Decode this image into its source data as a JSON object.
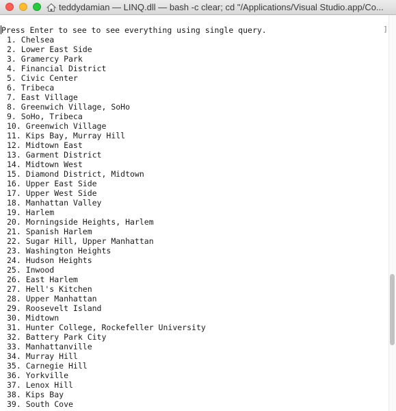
{
  "window": {
    "title": "teddydamian — LINQ.dll — bash -c clear; cd \"/Applications/Visual Studio.app/Co..."
  },
  "terminal": {
    "prompt_line": "Press Enter to see to see everything using single query.",
    "items": [
      "1. Chelsea",
      "2. Lower East Side",
      "3. Gramercy Park",
      "4. Financial District",
      "5. Civic Center",
      "6. Tribeca",
      "7. East Village",
      "8. Greenwich Village, SoHo",
      "9. SoHo, Tribeca",
      "10. Greenwich Village",
      "11. Kips Bay, Murray Hill",
      "12. Midtown East",
      "13. Garment District",
      "14. Midtown West",
      "15. Diamond District, Midtown",
      "16. Upper East Side",
      "17. Upper West Side",
      "18. Manhattan Valley",
      "19. Harlem",
      "20. Morningside Heights, Harlem",
      "21. Spanish Harlem",
      "22. Sugar Hill, Upper Manhattan",
      "23. Washington Heights",
      "24. Hudson Heights",
      "25. Inwood",
      "26. East Harlem",
      "27. Hell's Kitchen",
      "28. Upper Manhattan",
      "29. Roosevelt Island",
      "30. Midtown",
      "31. Hunter College, Rockefeller University",
      "32. Battery Park City",
      "33. Manhattanville",
      "34. Murray Hill",
      "35. Carnegie Hill",
      "36. Yorkville",
      "37. Lenox Hill",
      "38. Kips Bay",
      "39. South Cove"
    ]
  },
  "icons": {
    "close": "close-button",
    "minimize": "minimize-button",
    "maximize": "maximize-button",
    "title": "home-folder-icon"
  },
  "colors": {
    "close": "#fe5f57",
    "minimize": "#febc2e",
    "maximize": "#28c840"
  }
}
